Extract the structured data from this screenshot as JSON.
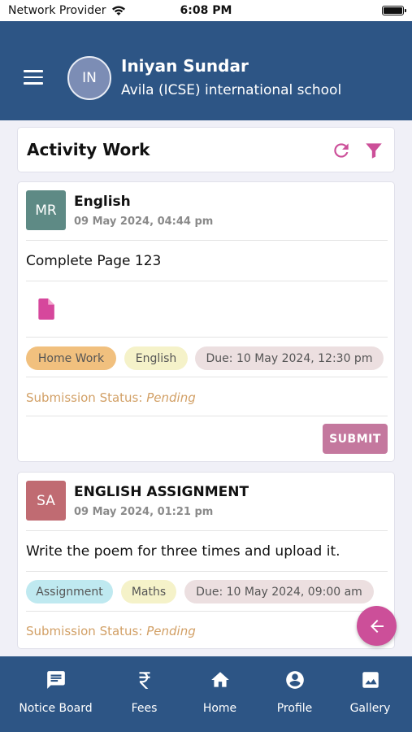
{
  "status_bar": {
    "carrier": "Network Provider",
    "time": "6:08 PM"
  },
  "header": {
    "avatar_initials": "IN",
    "user_name": "Iniyan Sundar",
    "school": "Avila (ICSE) international school"
  },
  "page": {
    "title": "Activity Work",
    "icons": [
      "refresh-icon",
      "filter-icon"
    ]
  },
  "activities": [
    {
      "avatar_initials": "MR",
      "avatar_color": "#5e8a85",
      "subject": "English",
      "date": "09 May 2024, 04:44 pm",
      "description": "Complete Page 123",
      "attachment_icon": "document-icon",
      "tags": [
        "Home Work",
        "English",
        "Due: 10 May 2024, 12:30 pm"
      ],
      "status_label": "Submission Status:",
      "status_value": "Pending",
      "action_label": "SUBMIT"
    },
    {
      "avatar_initials": "SA",
      "avatar_color": "#c06b72",
      "subject": "ENGLISH ASSIGNMENT",
      "date": "09 May 2024, 01:21 pm",
      "description": "Write the poem for three times and upload it.",
      "tags": [
        "Assignment",
        "Maths",
        "Due: 10 May 2024, 09:00 am"
      ],
      "status_label": "Submission Status:",
      "status_value": "Pending"
    }
  ],
  "fab": {
    "icon": "arrow-left-icon"
  },
  "bottom_nav": [
    {
      "label": "Notice Board",
      "icon": "notice-board-icon"
    },
    {
      "label": "Fees",
      "icon": "rupee-icon"
    },
    {
      "label": "Home",
      "icon": "home-icon"
    },
    {
      "label": "Profile",
      "icon": "profile-icon"
    },
    {
      "label": "Gallery",
      "icon": "gallery-icon"
    }
  ],
  "colors": {
    "primary": "#2d5585",
    "accent": "#cc4f99",
    "status_text": "#d2a066"
  }
}
